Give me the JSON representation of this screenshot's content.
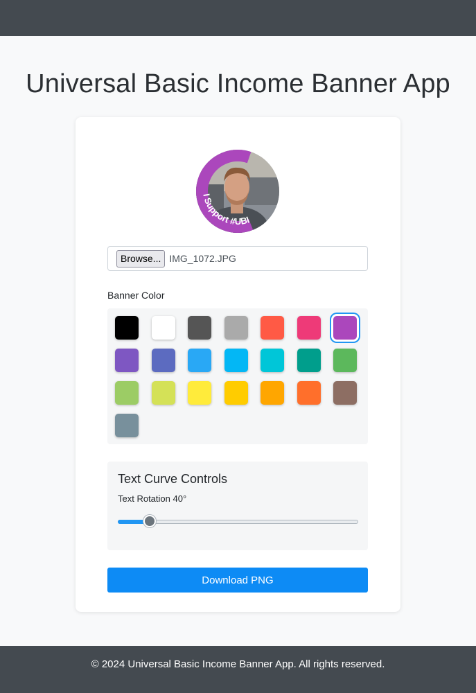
{
  "header": {
    "title": "Universal Basic Income Banner App"
  },
  "avatar": {
    "banner_text": "I Support #UBI",
    "banner_color": "#ab47bc"
  },
  "file_input": {
    "button_label": "Browse...",
    "file_name": "IMG_1072.JPG"
  },
  "banner_color": {
    "label": "Banner Color",
    "selected": "#ab47bc",
    "swatches": [
      "#000000",
      "#ffffff",
      "#555555",
      "#aaaaaa",
      "#ff5a45",
      "#ee3a78",
      "#ab47bc",
      "#7e57c2",
      "#5c6bc0",
      "#29a8f5",
      "#03b7f5",
      "#00c6d8",
      "#009e8c",
      "#5cb85c",
      "#9ccc65",
      "#d4e157",
      "#ffeb3b",
      "#ffcc00",
      "#ffa600",
      "#ff6f2b",
      "#8d6e63",
      "#78909c"
    ]
  },
  "text_curve": {
    "title": "Text Curve Controls",
    "rotation_label": "Text Rotation 40°",
    "rotation_value": 40
  },
  "download": {
    "label": "Download PNG"
  },
  "footer": {
    "text": "© 2024 Universal Basic Income Banner App. All rights reserved."
  }
}
